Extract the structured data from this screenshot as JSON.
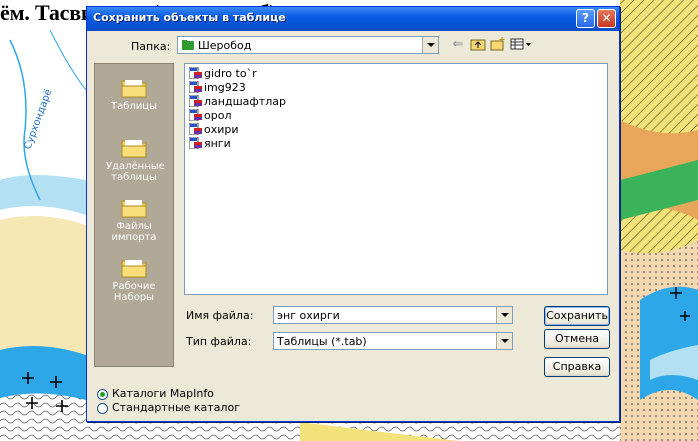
{
  "caption": "ём. Тасвирлар а) растрли, б) векторли тасвир ка",
  "map_label": "Сурхондарё",
  "dialog": {
    "title": "Сохранить объекты в таблице",
    "help_glyph": "?",
    "close_glyph": "✕",
    "folder_label": "Папка:",
    "folder_value": "Шеробод",
    "places": [
      {
        "label": "Таблицы"
      },
      {
        "label": "Удалённые таблицы"
      },
      {
        "label": "Файлы импорта"
      },
      {
        "label": "Рабочие Наборы"
      }
    ],
    "files": [
      "gidro to`r",
      "img923",
      "ландшафтлар",
      "орол",
      "охири",
      "янги"
    ],
    "file_name_label": "Имя файла:",
    "file_name_value": "энг охирги",
    "file_type_label": "Тип файла:",
    "file_type_value": "Таблицы (*.tab)",
    "save_label": "Сохранить",
    "cancel_label": "Отмена",
    "help_label": "Справка",
    "radio_mapinfo": "Каталоги MapInfo",
    "radio_standard": "Стандартные каталог"
  },
  "colors": {
    "title_blue": "#0654d8",
    "dialog_face": "#ece9d8",
    "places_bar": "#b1a997",
    "map_yellow": "#f2e27a",
    "map_river": "#2ea7e8",
    "map_orange": "#e8a65a"
  },
  "icons": {
    "back": "back-arrow-icon",
    "up": "up-folder-icon",
    "new_folder": "new-folder-icon",
    "view": "view-menu-icon"
  }
}
